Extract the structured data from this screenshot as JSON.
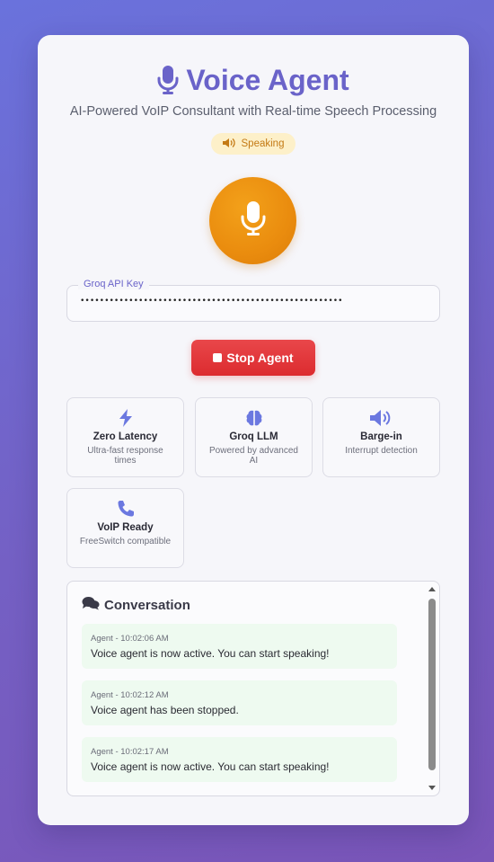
{
  "header": {
    "title": "Voice Agent",
    "subtitle": "AI-Powered VoIP Consultant with Real-time Speech Processing",
    "status": "Speaking"
  },
  "api_key": {
    "label": "Groq API Key",
    "value": "••••••••••••••••••••••••••••••••••••••••••••••••••••••"
  },
  "actions": {
    "stop_label": "Stop Agent"
  },
  "features": [
    {
      "icon": "bolt-icon",
      "name": "Zero Latency",
      "desc": "Ultra-fast response times"
    },
    {
      "icon": "brain-icon",
      "name": "Groq LLM",
      "desc": "Powered by advanced AI"
    },
    {
      "icon": "speaker-icon",
      "name": "Barge-in",
      "desc": "Interrupt detection"
    },
    {
      "icon": "phone-icon",
      "name": "VoIP Ready",
      "desc": "FreeSwitch compatible"
    }
  ],
  "conversation": {
    "title": "Conversation",
    "messages": [
      {
        "meta": "Agent - 10:02:06 AM",
        "text": "Voice agent is now active. You can start speaking!"
      },
      {
        "meta": "Agent - 10:02:12 AM",
        "text": "Voice agent has been stopped."
      },
      {
        "meta": "Agent - 10:02:17 AM",
        "text": "Voice agent is now active. You can start speaking!"
      }
    ]
  },
  "colors": {
    "accent": "#6a63c9",
    "speaking_bg": "#fdf0c9",
    "mic_orange": "#ea8c0e",
    "stop_red": "#dc2b2f",
    "message_bg": "#eefaf0"
  }
}
